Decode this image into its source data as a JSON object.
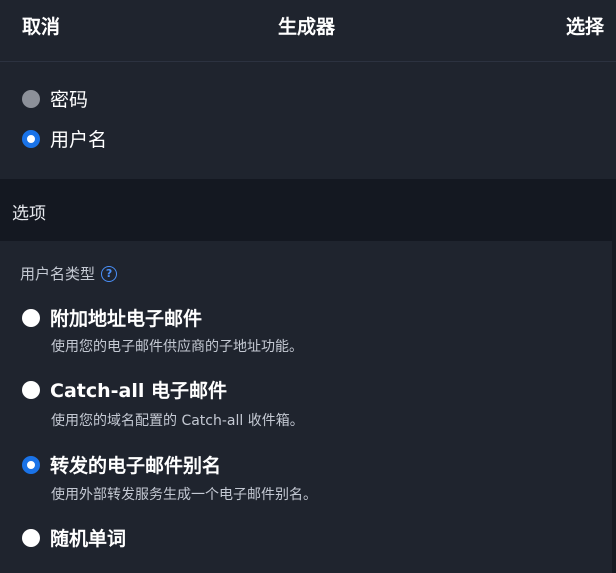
{
  "header": {
    "cancel_label": "取消",
    "title": "生成器",
    "select_label": "选择"
  },
  "generate_type": {
    "items": [
      {
        "label": "密码",
        "selected": false
      },
      {
        "label": "用户名",
        "selected": true
      }
    ]
  },
  "options_section": {
    "title": "选项"
  },
  "username_type": {
    "label": "用户名类型",
    "help_icon": "help-circle-icon",
    "help_glyph": "?",
    "items": [
      {
        "label": "附加地址电子邮件",
        "description": "使用您的电子邮件供应商的子地址功能。",
        "selected": false
      },
      {
        "label": "Catch-all 电子邮件",
        "description": "使用您的域名配置的 Catch-all 收件箱。",
        "selected": false
      },
      {
        "label": "转发的电子邮件别名",
        "description": "使用外部转发服务生成一个电子邮件别名。",
        "selected": true
      },
      {
        "label": "随机单词",
        "description": "",
        "selected": false
      }
    ]
  },
  "colors": {
    "background": "#1f242e",
    "section_header_bg": "#141821",
    "accent": "#1a73e8"
  }
}
